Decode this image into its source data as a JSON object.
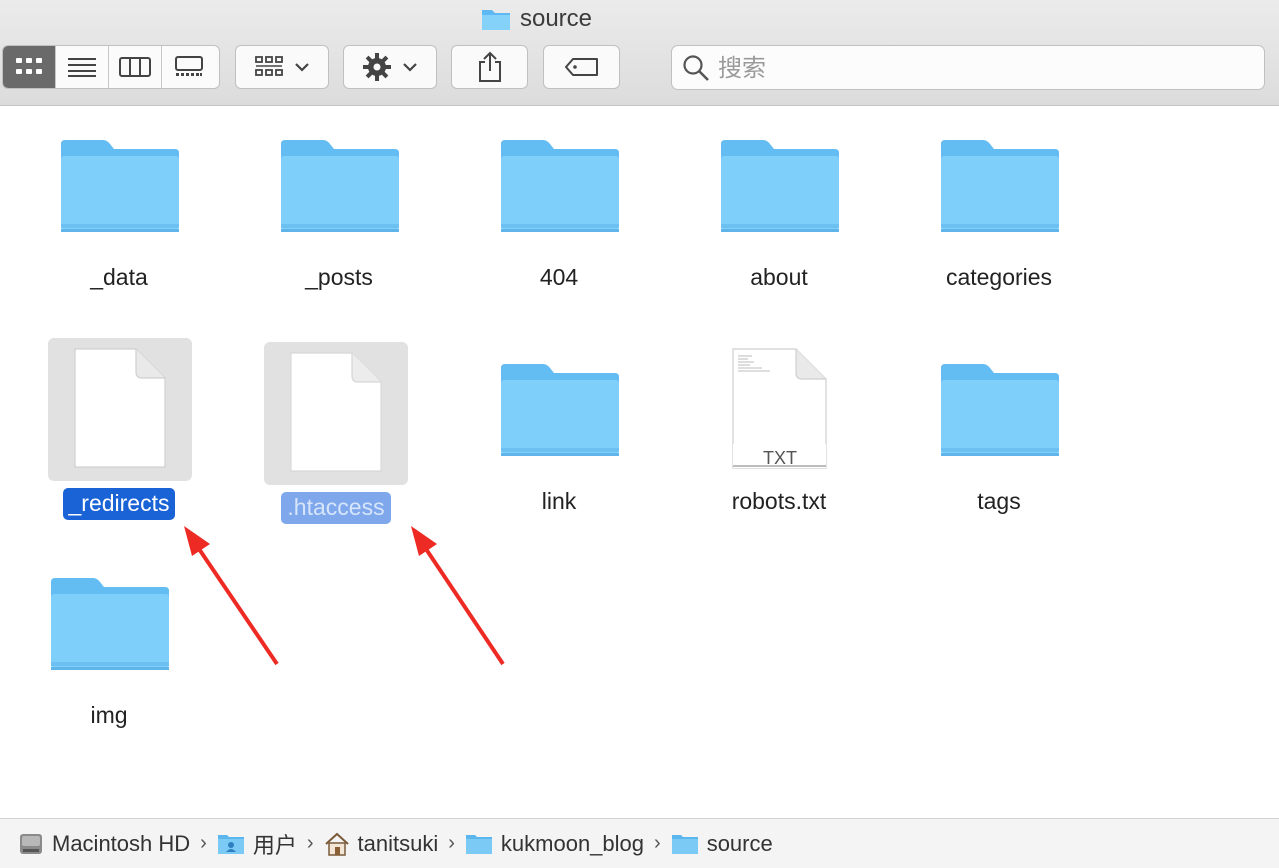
{
  "window": {
    "title": "source"
  },
  "toolbar": {
    "view_modes": [
      "icon-view",
      "list-view",
      "column-view",
      "gallery-view"
    ],
    "active_view": "icon-view",
    "group_icon": "group-grid-icon",
    "action_icon": "gear-icon",
    "share_icon": "share-icon",
    "tag_icon": "tag-icon"
  },
  "search": {
    "placeholder": "搜索",
    "value": ""
  },
  "items": [
    {
      "name": "_data",
      "kind": "folder",
      "selected": "none"
    },
    {
      "name": "_posts",
      "kind": "folder",
      "selected": "none"
    },
    {
      "name": "404",
      "kind": "folder",
      "selected": "none"
    },
    {
      "name": "about",
      "kind": "folder",
      "selected": "none"
    },
    {
      "name": "categories",
      "kind": "folder",
      "selected": "none"
    },
    {
      "name": "_redirects",
      "kind": "document",
      "selected": "primary"
    },
    {
      "name": ".htaccess",
      "kind": "document",
      "selected": "secondary"
    },
    {
      "name": "link",
      "kind": "folder",
      "selected": "none"
    },
    {
      "name": "robots.txt",
      "kind": "text",
      "badge": "TXT",
      "selected": "none"
    },
    {
      "name": "tags",
      "kind": "folder",
      "selected": "none"
    },
    {
      "name": "img",
      "kind": "folder",
      "selected": "none"
    }
  ],
  "pathbar": [
    {
      "label": "Macintosh HD",
      "icon": "hard-drive-icon"
    },
    {
      "label": "用户",
      "icon": "users-folder-icon"
    },
    {
      "label": "tanitsuki",
      "icon": "home-icon"
    },
    {
      "label": "kukmoon_blog",
      "icon": "folder-icon"
    },
    {
      "label": "source",
      "icon": "folder-icon"
    }
  ],
  "colors": {
    "folder": "#6cc4f7",
    "selection_primary": "#1a63d6",
    "selection_secondary": "#7ea7ec",
    "annotation_arrow": "#ee2a24"
  }
}
